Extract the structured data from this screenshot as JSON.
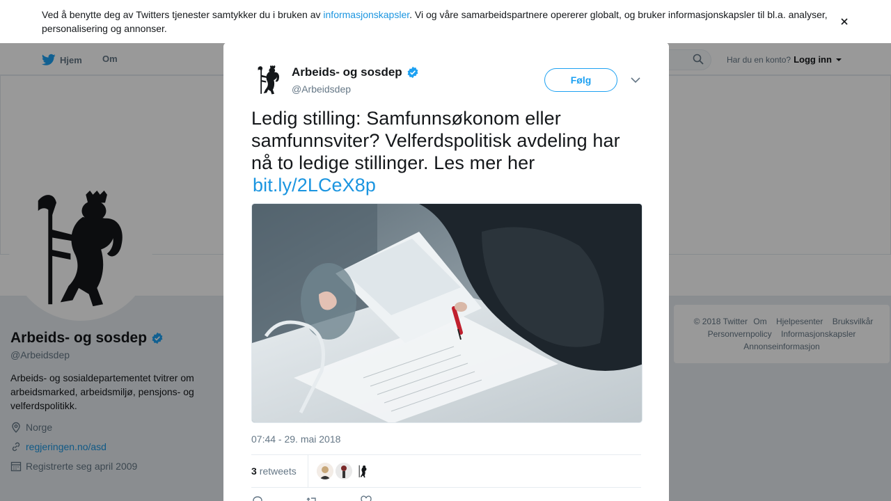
{
  "cookie_banner": {
    "text_before": "Ved å benytte deg av Twitters tjenester samtykker du i bruken av ",
    "link": "informasjonskapsler",
    "text_after": ". Vi og våre samarbeidspartnere opererer globalt, og bruker informasjonskapsler til bl.a. analyser, personalisering og annonser."
  },
  "nav": {
    "home": "Hjem",
    "about": "Om",
    "login_prompt": "Har du en konto?",
    "login": "Logg inn"
  },
  "profile": {
    "name": "Arbeids- og sosdep",
    "handle": "@Arbeidsdep",
    "bio": "Arbeids- og sosialdepartementet tvitrer om arbeidsmarked, arbeidsmiljø, pensjons- og velferdspolitikk.",
    "location": "Norge",
    "website": "regjeringen.no/asd",
    "joined": "Registrerte seg april 2009"
  },
  "footer": {
    "links": [
      "© 2018 Twitter",
      "Om",
      "Hjelpesenter",
      "Bruksvilkår",
      "Personvernpolicy",
      "Informasjonskapsler",
      "Annonseinformasjon"
    ]
  },
  "tweet": {
    "name": "Arbeids- og sosdep",
    "handle": "@Arbeidsdep",
    "follow": "Følg",
    "text": "Ledig stilling: Samfunnsøkonom eller samfunnsviter? Velferdspolitisk avdeling har nå to ledige stillinger. Les mer her",
    "link": "bit.ly/2LCeX8p",
    "timestamp": "07:44 - 29. mai 2018",
    "retweet_count": "3",
    "retweet_label": "retweets",
    "reply_count": "",
    "retweet_action_count": "3"
  },
  "colors": {
    "link": "#1b95e0",
    "accent": "#1da1f2"
  }
}
